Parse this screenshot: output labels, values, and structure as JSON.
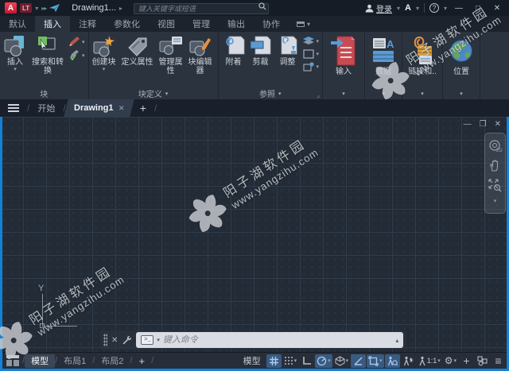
{
  "colors": {
    "accent": "#1581d6",
    "titlebar": "#161c25",
    "ribbon": "#2b333f",
    "canvas": "#232b36",
    "status_highlight": "#3a5a80",
    "watermark": "#d6dade"
  },
  "icons": {
    "caret_down": "▾",
    "caret_up": "▴",
    "caret_right": "▸",
    "double_arrow": "▸▸",
    "close": "✕",
    "minimize": "—",
    "maximize": "❐",
    "restore": "□",
    "plus": "+",
    "hamburger": "≡",
    "gear": "⚙",
    "slash": "/",
    "launcher": "⌟",
    "question": "?",
    "letter_a": "A",
    "prompt": ">_",
    "wheel_2d": "2D"
  },
  "titlebar": {
    "logo_a": "A",
    "logo_lt": "LT",
    "doc_title": "Drawing1...",
    "search_placeholder": "键入关键字或短语",
    "signin_label": "登录"
  },
  "ribbon": {
    "active_tab": "插入",
    "tabs": [
      {
        "label": "默认"
      },
      {
        "label": "插入"
      },
      {
        "label": "注释"
      },
      {
        "label": "参数化"
      },
      {
        "label": "视图"
      },
      {
        "label": "管理"
      },
      {
        "label": "输出"
      },
      {
        "label": "协作"
      }
    ],
    "panels": {
      "block": {
        "title": "块",
        "insert": "插入",
        "search_convert": "搜索和转换"
      },
      "block_def": {
        "title": "块定义",
        "create": "创建块",
        "define_attr": "定义属性",
        "manage_attr": "管理属性",
        "block_editor": "块编辑器"
      },
      "reference": {
        "title": "参照",
        "attach": "附着",
        "clip": "剪裁",
        "adjust": "调整"
      },
      "import": {
        "label": "输入"
      },
      "data": {
        "label": "数据"
      },
      "link": {
        "label": "链接和.."
      },
      "location": {
        "label": "位置"
      }
    }
  },
  "filetabs": {
    "start": "开始",
    "drawing": "Drawing1"
  },
  "canvas": {
    "ucs_y_label": "Y"
  },
  "command": {
    "placeholder": "键入命令"
  },
  "statusbar": {
    "layout_tabs": [
      {
        "label": "模型"
      },
      {
        "label": "布局1"
      },
      {
        "label": "布局2"
      }
    ],
    "model_button": "模型",
    "annotation_scale": "1:1"
  },
  "watermark": {
    "line1": "阳子湖软件园",
    "line2": "www.yangzihu.com"
  }
}
